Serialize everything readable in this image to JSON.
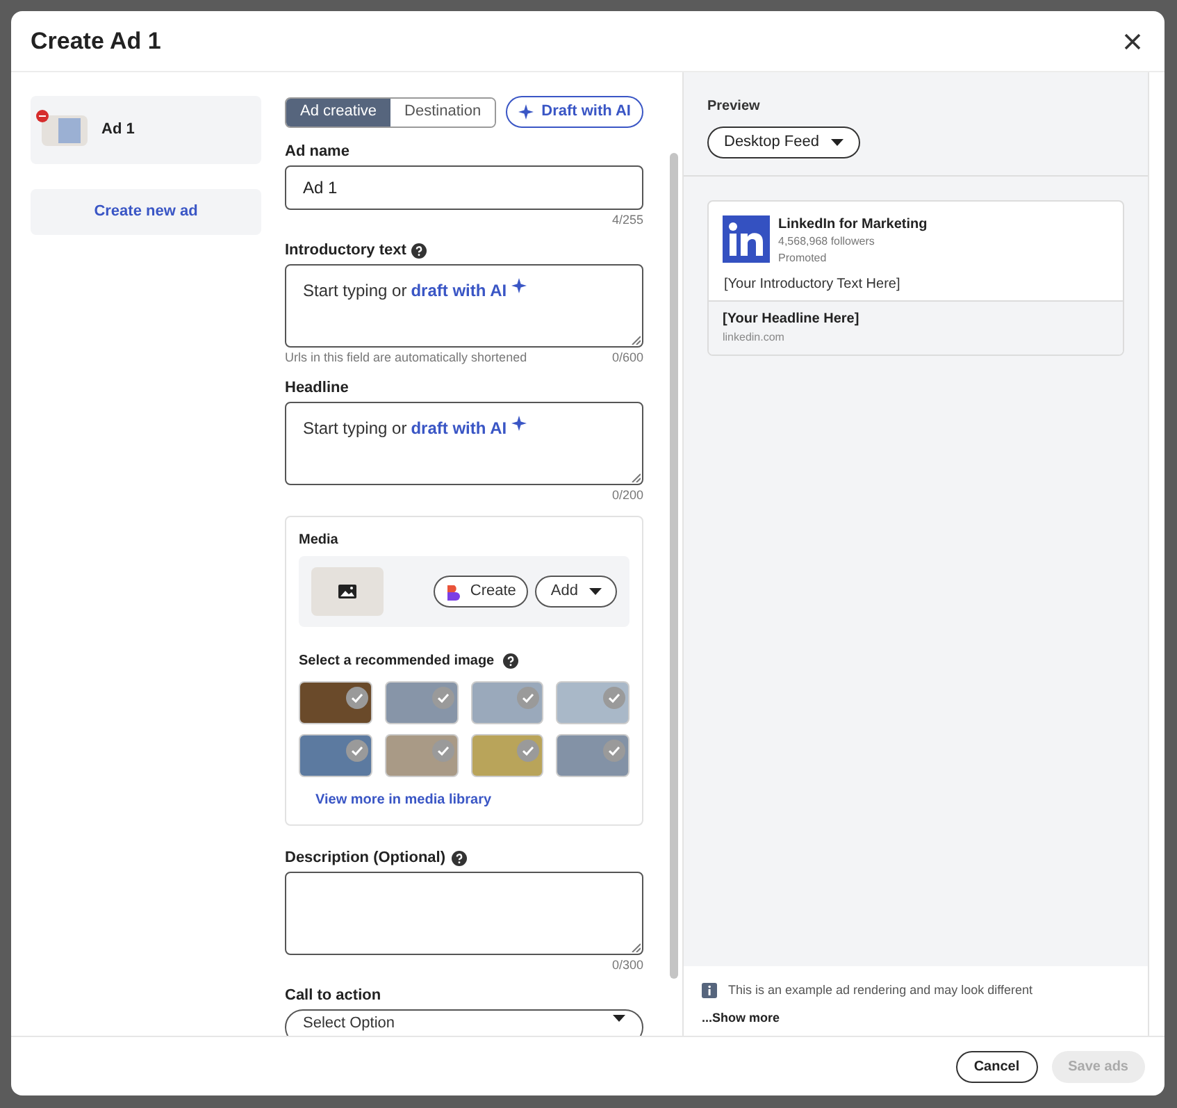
{
  "dialog": {
    "title": "Create Ad 1"
  },
  "ads": [
    {
      "label": "Ad 1",
      "selected": true,
      "error": true
    }
  ],
  "create_ad_button": "Create new ad",
  "tabs": [
    {
      "label": "Ad creative",
      "selected": true
    },
    {
      "label": "Destination",
      "selected": false
    }
  ],
  "draft_button": "Draft with AI",
  "ad_name": {
    "label": "Ad name",
    "value": "Ad 1",
    "counter": "4/255"
  },
  "introductory_text": {
    "label": "Introductory text",
    "help": true,
    "prompt": "Start typing or",
    "prompt_link": "draft with AI",
    "hint": "Urls in this field are automatically shortened",
    "counter": "0/600"
  },
  "headline": {
    "label": "Headline",
    "help": false,
    "prompt": "Start typing or",
    "prompt_link": "draft with AI",
    "counter": "0/200"
  },
  "media": {
    "label": "Media",
    "create_button": "Create",
    "add_button": "Add",
    "recommended_label": "Select a recommended image",
    "images": [
      {
        "kind": "photo"
      },
      {
        "kind": "photo"
      },
      {
        "kind": "photo"
      },
      {
        "kind": "photo"
      },
      {
        "kind": "photo"
      },
      {
        "kind": "photo"
      },
      {
        "kind": "photo"
      },
      {
        "kind": "photo"
      }
    ],
    "library_link": "View more in media library"
  },
  "description": {
    "label": "Description (Optional)",
    "help": true,
    "counter": "0/300"
  },
  "call_to_action": {
    "label": "Call to action",
    "placeholder": "Select Option"
  },
  "preview": {
    "label": "Preview",
    "format": "Desktop Feed",
    "company": "LinkedIn for Marketing",
    "followers": "4,568,968 followers",
    "promoted": "Promoted",
    "intro": "[Your Introductory Text Here]",
    "headline": "[Your Headline Here]",
    "domain": "linkedin.com",
    "notice": "This is an example ad rendering and may look different",
    "show_more": "...Show more"
  },
  "footer_buttons": [
    {
      "label": "Cancel",
      "disabled": false
    },
    {
      "label": "Save ads",
      "disabled": true
    }
  ]
}
